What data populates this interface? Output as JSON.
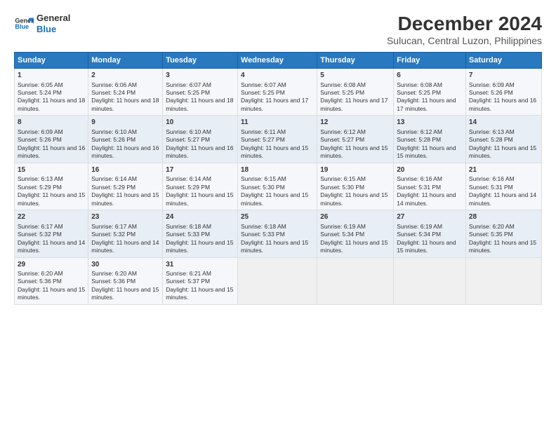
{
  "logo": {
    "line1": "General",
    "line2": "Blue"
  },
  "title": "December 2024",
  "subtitle": "Sulucan, Central Luzon, Philippines",
  "days_of_week": [
    "Sunday",
    "Monday",
    "Tuesday",
    "Wednesday",
    "Thursday",
    "Friday",
    "Saturday"
  ],
  "weeks": [
    [
      {
        "day": "1",
        "sunrise": "Sunrise: 6:05 AM",
        "sunset": "Sunset: 5:24 PM",
        "daylight": "Daylight: 11 hours and 18 minutes."
      },
      {
        "day": "2",
        "sunrise": "Sunrise: 6:06 AM",
        "sunset": "Sunset: 5:24 PM",
        "daylight": "Daylight: 11 hours and 18 minutes."
      },
      {
        "day": "3",
        "sunrise": "Sunrise: 6:07 AM",
        "sunset": "Sunset: 5:25 PM",
        "daylight": "Daylight: 11 hours and 18 minutes."
      },
      {
        "day": "4",
        "sunrise": "Sunrise: 6:07 AM",
        "sunset": "Sunset: 5:25 PM",
        "daylight": "Daylight: 11 hours and 17 minutes."
      },
      {
        "day": "5",
        "sunrise": "Sunrise: 6:08 AM",
        "sunset": "Sunset: 5:25 PM",
        "daylight": "Daylight: 11 hours and 17 minutes."
      },
      {
        "day": "6",
        "sunrise": "Sunrise: 6:08 AM",
        "sunset": "Sunset: 5:25 PM",
        "daylight": "Daylight: 11 hours and 17 minutes."
      },
      {
        "day": "7",
        "sunrise": "Sunrise: 6:09 AM",
        "sunset": "Sunset: 5:26 PM",
        "daylight": "Daylight: 11 hours and 16 minutes."
      }
    ],
    [
      {
        "day": "8",
        "sunrise": "Sunrise: 6:09 AM",
        "sunset": "Sunset: 5:26 PM",
        "daylight": "Daylight: 11 hours and 16 minutes."
      },
      {
        "day": "9",
        "sunrise": "Sunrise: 6:10 AM",
        "sunset": "Sunset: 5:26 PM",
        "daylight": "Daylight: 11 hours and 16 minutes."
      },
      {
        "day": "10",
        "sunrise": "Sunrise: 6:10 AM",
        "sunset": "Sunset: 5:27 PM",
        "daylight": "Daylight: 11 hours and 16 minutes."
      },
      {
        "day": "11",
        "sunrise": "Sunrise: 6:11 AM",
        "sunset": "Sunset: 5:27 PM",
        "daylight": "Daylight: 11 hours and 15 minutes."
      },
      {
        "day": "12",
        "sunrise": "Sunrise: 6:12 AM",
        "sunset": "Sunset: 5:27 PM",
        "daylight": "Daylight: 11 hours and 15 minutes."
      },
      {
        "day": "13",
        "sunrise": "Sunrise: 6:12 AM",
        "sunset": "Sunset: 5:28 PM",
        "daylight": "Daylight: 11 hours and 15 minutes."
      },
      {
        "day": "14",
        "sunrise": "Sunrise: 6:13 AM",
        "sunset": "Sunset: 5:28 PM",
        "daylight": "Daylight: 11 hours and 15 minutes."
      }
    ],
    [
      {
        "day": "15",
        "sunrise": "Sunrise: 6:13 AM",
        "sunset": "Sunset: 5:29 PM",
        "daylight": "Daylight: 11 hours and 15 minutes."
      },
      {
        "day": "16",
        "sunrise": "Sunrise: 6:14 AM",
        "sunset": "Sunset: 5:29 PM",
        "daylight": "Daylight: 11 hours and 15 minutes."
      },
      {
        "day": "17",
        "sunrise": "Sunrise: 6:14 AM",
        "sunset": "Sunset: 5:29 PM",
        "daylight": "Daylight: 11 hours and 15 minutes."
      },
      {
        "day": "18",
        "sunrise": "Sunrise: 6:15 AM",
        "sunset": "Sunset: 5:30 PM",
        "daylight": "Daylight: 11 hours and 15 minutes."
      },
      {
        "day": "19",
        "sunrise": "Sunrise: 6:15 AM",
        "sunset": "Sunset: 5:30 PM",
        "daylight": "Daylight: 11 hours and 15 minutes."
      },
      {
        "day": "20",
        "sunrise": "Sunrise: 6:16 AM",
        "sunset": "Sunset: 5:31 PM",
        "daylight": "Daylight: 11 hours and 14 minutes."
      },
      {
        "day": "21",
        "sunrise": "Sunrise: 6:16 AM",
        "sunset": "Sunset: 5:31 PM",
        "daylight": "Daylight: 11 hours and 14 minutes."
      }
    ],
    [
      {
        "day": "22",
        "sunrise": "Sunrise: 6:17 AM",
        "sunset": "Sunset: 5:32 PM",
        "daylight": "Daylight: 11 hours and 14 minutes."
      },
      {
        "day": "23",
        "sunrise": "Sunrise: 6:17 AM",
        "sunset": "Sunset: 5:32 PM",
        "daylight": "Daylight: 11 hours and 14 minutes."
      },
      {
        "day": "24",
        "sunrise": "Sunrise: 6:18 AM",
        "sunset": "Sunset: 5:33 PM",
        "daylight": "Daylight: 11 hours and 15 minutes."
      },
      {
        "day": "25",
        "sunrise": "Sunrise: 6:18 AM",
        "sunset": "Sunset: 5:33 PM",
        "daylight": "Daylight: 11 hours and 15 minutes."
      },
      {
        "day": "26",
        "sunrise": "Sunrise: 6:19 AM",
        "sunset": "Sunset: 5:34 PM",
        "daylight": "Daylight: 11 hours and 15 minutes."
      },
      {
        "day": "27",
        "sunrise": "Sunrise: 6:19 AM",
        "sunset": "Sunset: 5:34 PM",
        "daylight": "Daylight: 11 hours and 15 minutes."
      },
      {
        "day": "28",
        "sunrise": "Sunrise: 6:20 AM",
        "sunset": "Sunset: 5:35 PM",
        "daylight": "Daylight: 11 hours and 15 minutes."
      }
    ],
    [
      {
        "day": "29",
        "sunrise": "Sunrise: 6:20 AM",
        "sunset": "Sunset: 5:36 PM",
        "daylight": "Daylight: 11 hours and 15 minutes."
      },
      {
        "day": "30",
        "sunrise": "Sunrise: 6:20 AM",
        "sunset": "Sunset: 5:36 PM",
        "daylight": "Daylight: 11 hours and 15 minutes."
      },
      {
        "day": "31",
        "sunrise": "Sunrise: 6:21 AM",
        "sunset": "Sunset: 5:37 PM",
        "daylight": "Daylight: 11 hours and 15 minutes."
      },
      null,
      null,
      null,
      null
    ]
  ]
}
